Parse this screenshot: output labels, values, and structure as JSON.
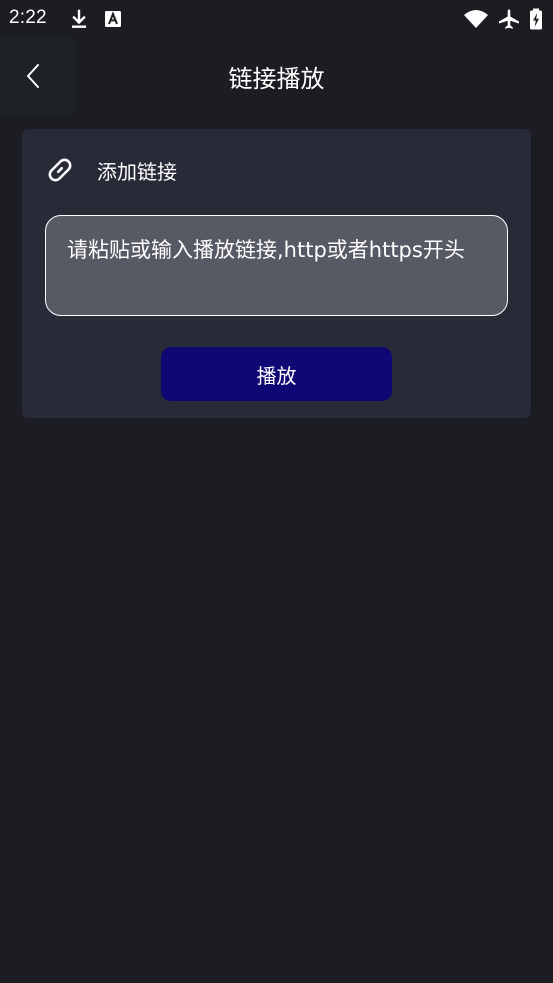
{
  "status_bar": {
    "time": "2:22",
    "icons": [
      "download-icon",
      "a-badge-icon",
      "wifi-icon",
      "airplane-icon",
      "battery-charging-icon"
    ]
  },
  "header": {
    "title": "链接播放",
    "back_icon": "chevron-left-icon"
  },
  "card": {
    "header_icon": "link-icon",
    "header_label": "添加链接",
    "input_placeholder": "请粘贴或输入播放链接,http或者https开头",
    "play_button_label": "播放"
  },
  "colors": {
    "background": "#1b1d22",
    "card": "#282a38",
    "input_fill": "#575a64",
    "button": "#0e0774",
    "text": "#ffffff"
  }
}
